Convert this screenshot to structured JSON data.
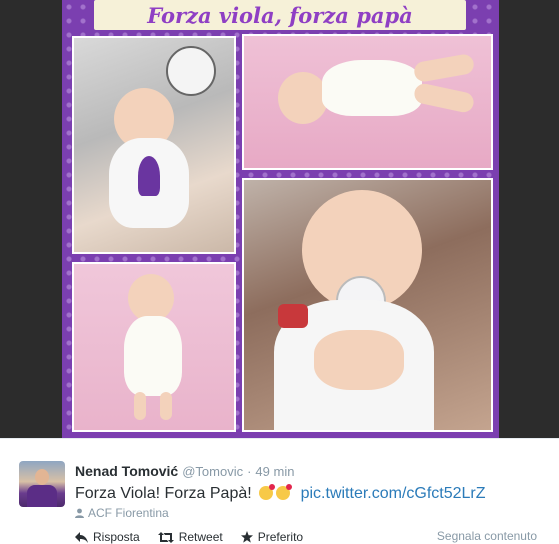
{
  "media": {
    "collage_title": "Forza viola, forza papà"
  },
  "tweet": {
    "author_name": "Nenad Tomović",
    "author_handle": "@Tomovic",
    "separator": "·",
    "time": "49 min",
    "text": "Forza Viola! Forza Papà!",
    "link": "pic.twitter.com/cGfct52LrZ",
    "location": "ACF Fiorentina",
    "actions": {
      "reply": "Risposta",
      "retweet": "Retweet",
      "favorite": "Preferito"
    },
    "report": "Segnala contenuto",
    "colors": {
      "link": "#2b7bb9",
      "muted": "#8899a6",
      "text": "#292f33",
      "collage_purple": "#7b3fb0"
    }
  }
}
